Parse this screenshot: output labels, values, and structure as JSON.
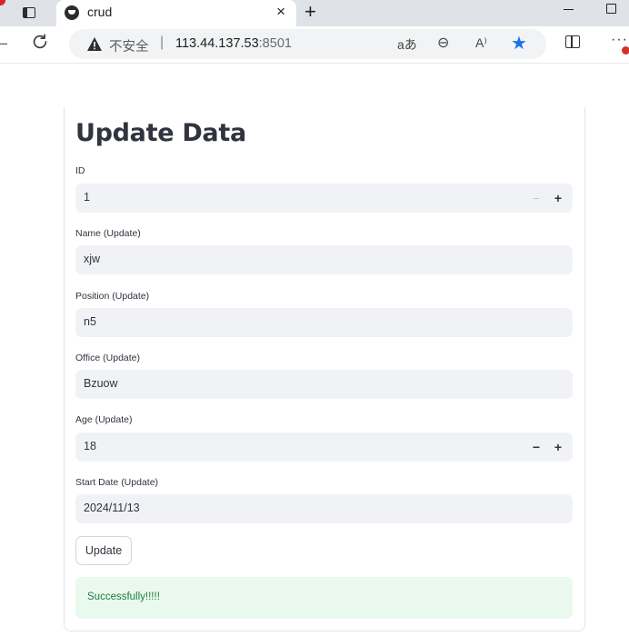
{
  "browser": {
    "tab_title": "crud",
    "tab_close": "×",
    "new_tab": "+",
    "security_label": "不安全",
    "url_separator": "|",
    "url_host": "113.44.137.53",
    "url_port": ":8501",
    "omnibox_icons": [
      "read-aloud-aa-icon",
      "zoom-out-icon",
      "read-aloud-icon",
      "favorite-star-icon"
    ],
    "aa_glyph": "aあ",
    "zoom_glyph": "⊖",
    "read_glyph": "A⁾",
    "more_glyph": "···",
    "accent_color": "#1a73e8"
  },
  "page": {
    "title": "Update Data",
    "fields": [
      {
        "label": "ID",
        "value": "1",
        "stepper": true,
        "minus_disabled": true
      },
      {
        "label": "Name (Update)",
        "value": "xjw"
      },
      {
        "label": "Position (Update)",
        "value": "n5"
      },
      {
        "label": "Office (Update)",
        "value": "Bzuow"
      },
      {
        "label": "Age (Update)",
        "value": "18",
        "stepper": true,
        "minus_disabled": false
      },
      {
        "label": "Start Date (Update)",
        "value": "2024/11/13"
      }
    ],
    "stepper_minus": "−",
    "stepper_plus": "+",
    "update_button": "Update",
    "success_message": "Successfully!!!!!",
    "success_color": "#e9f9ee"
  }
}
